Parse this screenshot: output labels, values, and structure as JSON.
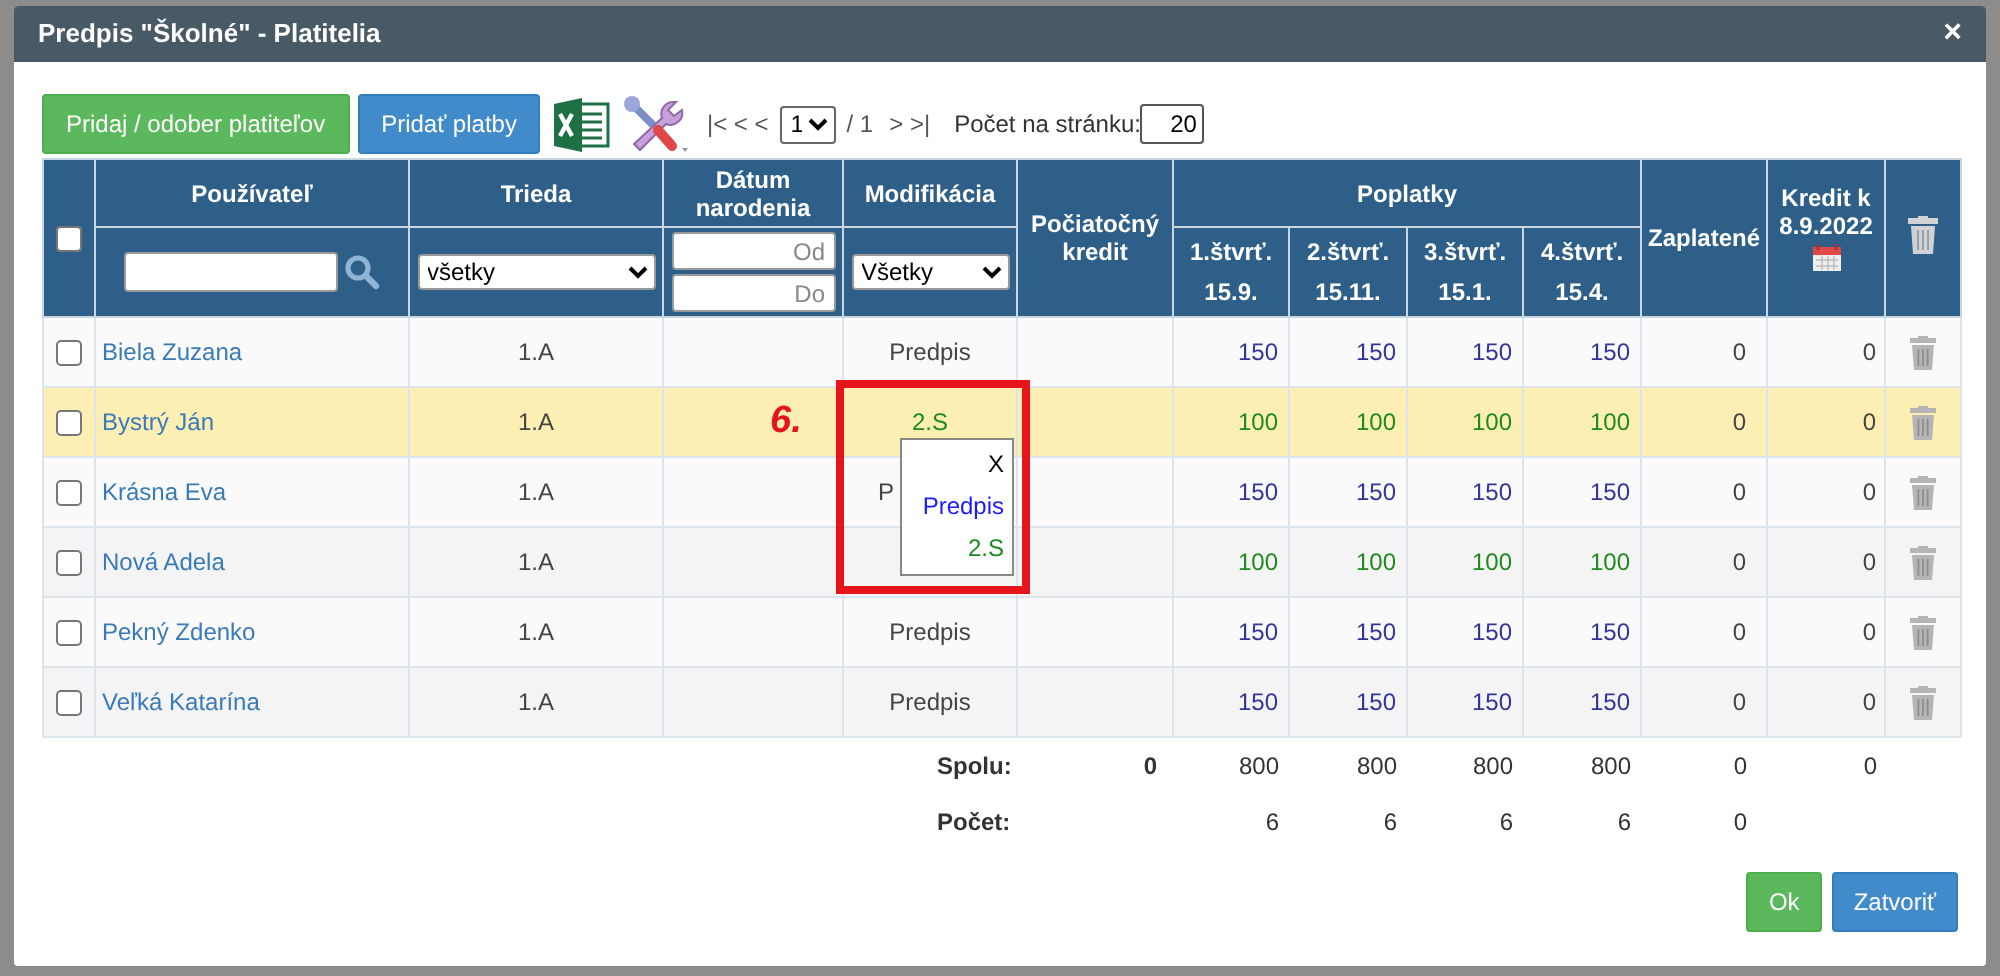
{
  "window": {
    "title": "Predpis \"Školné\" - Platitelia",
    "close": "×"
  },
  "toolbar": {
    "buttons": [
      {
        "label": "Pridaj / odober platiteľov",
        "kind": "success"
      },
      {
        "label": "Pridať platby",
        "kind": "primary"
      }
    ],
    "pager": {
      "back": "|< < <",
      "page": "1",
      "of": "/ 1",
      "forward": "> >|"
    },
    "page_size": {
      "label": "Počet na stránku:",
      "value": "20"
    }
  },
  "table": {
    "header": {
      "checked": false,
      "user": "Používateľ",
      "class": "Trieda",
      "birth": "Dátum narodenia",
      "modification": "Modifikácia",
      "initial_credit": "Počiatočný kredit",
      "fees": "Poplatky",
      "quarters": [
        {
          "name": "1.štvrť.",
          "due": "15.9."
        },
        {
          "name": "2.štvrť.",
          "due": "15.11."
        },
        {
          "name": "3.štvrť.",
          "due": "15.1."
        },
        {
          "name": "4.štvrť.",
          "due": "15.4."
        }
      ],
      "paid": "Zaplatené",
      "credit": "Kredit k 8.9.2022"
    },
    "filters": {
      "class": "všetky",
      "birth_range": [
        {
          "placeholder": "Od"
        },
        {
          "placeholder": "Do"
        }
      ],
      "modification": "Všetky"
    },
    "rows": [
      {
        "checked": false,
        "highlighted": false,
        "user": "Biela Zuzana",
        "class": "1.A",
        "modification": "Predpis",
        "kind": "standard",
        "fees": [
          "150",
          "150",
          "150",
          "150"
        ],
        "paid": "0",
        "credit": "0"
      },
      {
        "checked": false,
        "highlighted": true,
        "user": "Bystrý Ján",
        "class": "1.A",
        "modification": "2.S",
        "kind": "modified",
        "fees": [
          "100",
          "100",
          "100",
          "100"
        ],
        "paid": "0",
        "credit": "0"
      },
      {
        "checked": false,
        "highlighted": false,
        "user": "Krásna Eva",
        "class": "1.A",
        "modification": "P",
        "modification_partial": true,
        "kind": "standard",
        "fees": [
          "150",
          "150",
          "150",
          "150"
        ],
        "paid": "0",
        "credit": "0"
      },
      {
        "checked": false,
        "highlighted": false,
        "user": "Nová Adela",
        "class": "1.A",
        "kind": "modified",
        "fees": [
          "100",
          "100",
          "100",
          "100"
        ],
        "paid": "0",
        "credit": "0"
      },
      {
        "checked": false,
        "highlighted": false,
        "user": "Pekný Zdenko",
        "class": "1.A",
        "modification": "Predpis",
        "kind": "standard",
        "fees": [
          "150",
          "150",
          "150",
          "150"
        ],
        "paid": "0",
        "credit": "0"
      },
      {
        "checked": false,
        "highlighted": false,
        "user": "Veľká Katarína",
        "class": "1.A",
        "modification": "Predpis",
        "kind": "standard",
        "fees": [
          "150",
          "150",
          "150",
          "150"
        ],
        "paid": "0",
        "credit": "0"
      }
    ],
    "totals": [
      {
        "label": "Spolu:",
        "initial_credit": "0",
        "fees": [
          "800",
          "800",
          "800",
          "800"
        ],
        "paid": "0",
        "credit": "0"
      },
      {
        "label": "Počet:",
        "fees": [
          "6",
          "6",
          "6",
          "6"
        ],
        "paid": "0"
      }
    ]
  },
  "popup": {
    "items": [
      {
        "label": "X",
        "kind": "clear"
      },
      {
        "label": "Predpis",
        "kind": "standard"
      },
      {
        "label": "2.S",
        "kind": "modified"
      }
    ]
  },
  "annotation": {
    "label": "6."
  },
  "buttons": [
    {
      "label": "Ok",
      "kind": "success"
    },
    {
      "label": "Zatvoriť",
      "kind": "primary"
    }
  ]
}
